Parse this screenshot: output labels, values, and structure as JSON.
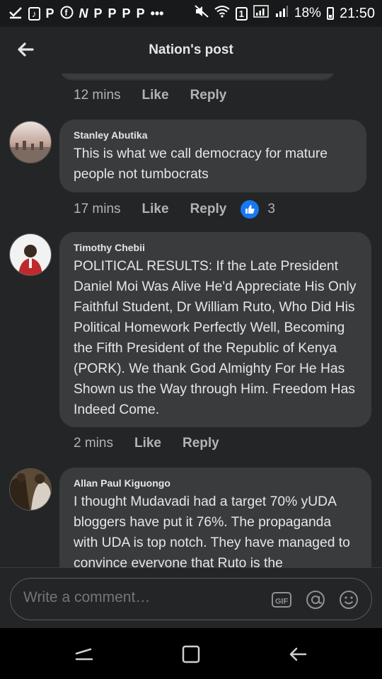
{
  "status_bar": {
    "battery": "18%",
    "time": "21:50",
    "sim": "1",
    "more": "•••",
    "app_icons": [
      "P",
      "P",
      "P",
      "P",
      "P"
    ]
  },
  "header": {
    "title": "Nation's post"
  },
  "previous_comment": {
    "time": "12 mins",
    "like": "Like",
    "reply": "Reply"
  },
  "comments": [
    {
      "author": "Stanley Abutika",
      "text": "This is what we call democracy for mature people not tumbocrats",
      "time": "17 mins",
      "like": "Like",
      "reply": "Reply",
      "reaction_count": "3"
    },
    {
      "author": "Timothy Chebii",
      "text": "POLITICAL RESULTS: If the Late President Daniel Moi Was Alive He'd Appreciate His Only Faithful Student, Dr William Ruto, Who Did His Political Homework Perfectly Well, Becoming the Fifth President of the Republic of Kenya (PORK). We thank God Almighty For He Has Shown us the Way through Him. Freedom Has Indeed Come.",
      "time": "2 mins",
      "like": "Like",
      "reply": "Reply"
    },
    {
      "author": "Allan Paul Kiguongo",
      "text": "I thought Mudavadi had a target 70% yUDA bloggers have put it 76%. The propaganda with UDA is top notch. They have managed to convince everyone that Ruto is the"
    }
  ],
  "composer": {
    "placeholder": "Write a comment…",
    "gif_label": "GIF",
    "mention_label": "@"
  },
  "colors": {
    "accent": "#1877f2",
    "bubble": "#3a3b3c",
    "background": "#242527"
  }
}
